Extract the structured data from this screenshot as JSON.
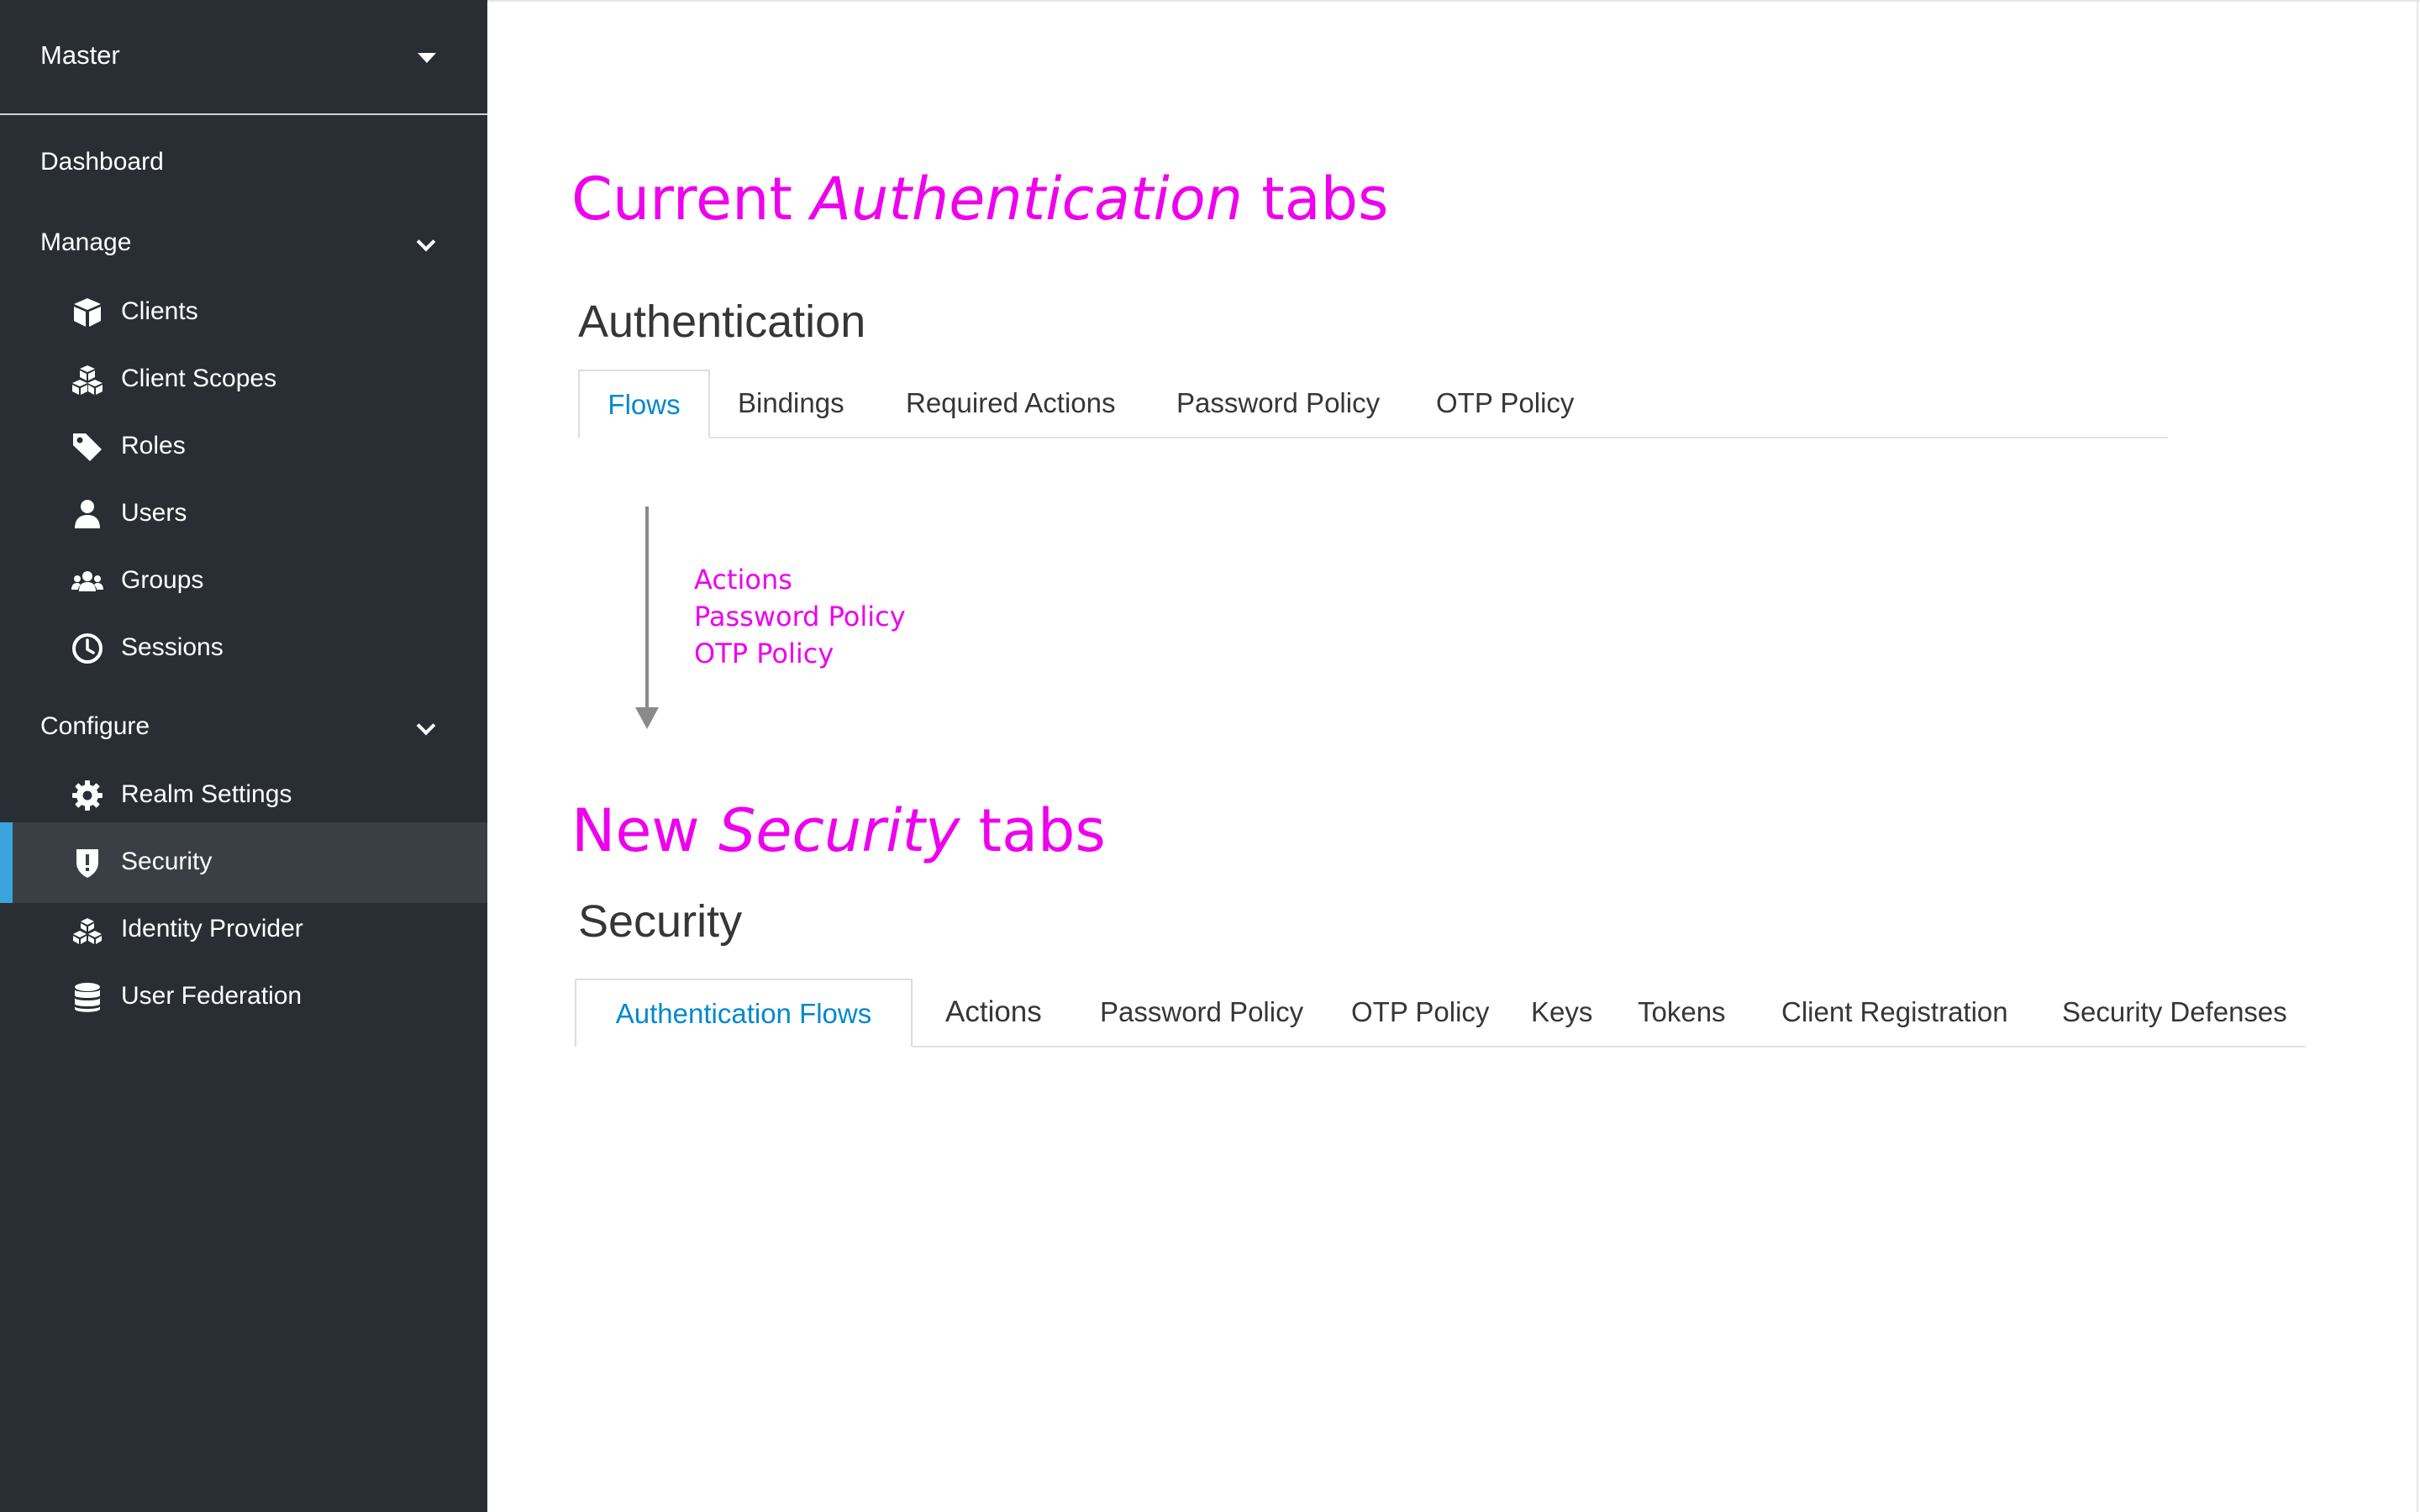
{
  "sidebar": {
    "realm": "Master",
    "dashboard": "Dashboard",
    "manage": {
      "label": "Manage",
      "items": [
        {
          "label": "Clients",
          "icon": "cube-icon"
        },
        {
          "label": "Client Scopes",
          "icon": "cubes-icon"
        },
        {
          "label": "Roles",
          "icon": "tag-icon"
        },
        {
          "label": "Users",
          "icon": "user-icon"
        },
        {
          "label": "Groups",
          "icon": "users-icon"
        },
        {
          "label": "Sessions",
          "icon": "clock-icon"
        }
      ]
    },
    "configure": {
      "label": "Configure",
      "items": [
        {
          "label": "Realm Settings",
          "icon": "gear-icon"
        },
        {
          "label": "Security",
          "icon": "shield-icon",
          "active": true
        },
        {
          "label": "Identity Provider",
          "icon": "stacked-cubes-icon"
        },
        {
          "label": "User Federation",
          "icon": "database-icon"
        }
      ]
    }
  },
  "annotations": {
    "current_heading": {
      "prefix": "Current ",
      "emph": "Authentication",
      "suffix": " tabs"
    },
    "new_heading": {
      "prefix": "New ",
      "emph": "Security",
      "suffix": " tabs"
    },
    "moved_items": [
      "Actions",
      "Password Policy",
      "OTP Policy"
    ]
  },
  "current": {
    "title": "Authentication",
    "tabs": [
      "Flows",
      "Bindings",
      "Required Actions",
      "Password Policy",
      "OTP Policy"
    ],
    "active_tab": "Flows"
  },
  "new": {
    "title": "Security",
    "tabs": [
      "Authentication Flows",
      "Actions",
      "Password Policy",
      "OTP Policy",
      "Keys",
      "Tokens",
      "Client Registration",
      "Security Defenses"
    ],
    "active_tab": "Authentication Flows"
  },
  "colors": {
    "sidebar_bg": "#292e34",
    "active_item_bg": "#393f44",
    "active_indicator": "#39a5dc",
    "annotation": "#ee00ee",
    "tab_active_text": "#0088ce"
  }
}
